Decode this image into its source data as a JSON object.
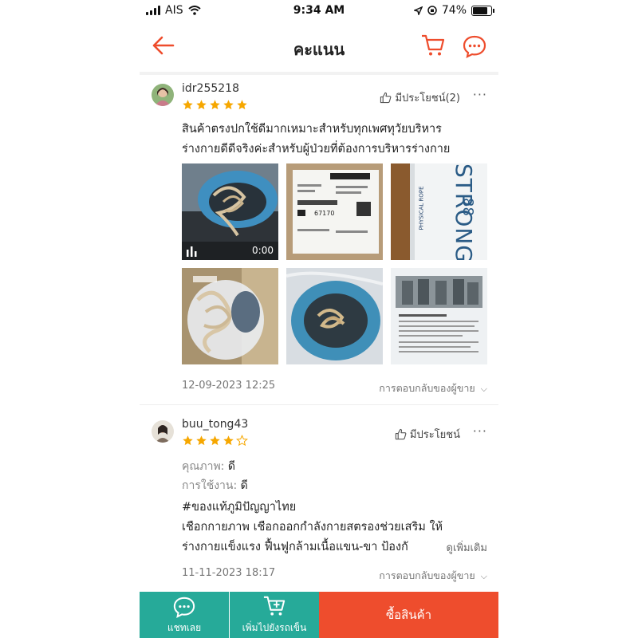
{
  "status_bar": {
    "carrier": "AIS",
    "time": "9:34 AM",
    "battery": "74%"
  },
  "header": {
    "title": "คะแนน",
    "back_icon": "arrow-left-icon",
    "cart_icon": "cart-icon",
    "chat_icon": "chat-icon"
  },
  "colors": {
    "accent": "#ee4d2d",
    "star": "#f6a700",
    "chat_green": "#26aa99"
  },
  "reviews": [
    {
      "username": "idr255218",
      "rating": 5,
      "helpful_label": "มีประโยชน์(2)",
      "text_lines": [
        "สินค้าตรงปกใช้ดีมากเหมาะสำหรับทุกเพศทุวัยบริหาร",
        "ร่างกายดีดีจริงค่ะสำหรับผู้ป่วยที่ต้องการบริหารร่างกาย"
      ],
      "video_duration": "0:00",
      "label_code": "67170",
      "packaging_text": "PHYSICAL ROPE",
      "packaging_brand": "STRONG",
      "packaging_number": "88",
      "date": "12-09-2023 12:25",
      "seller_reply_label": "การตอบกลับของผู้ขาย"
    },
    {
      "username": "buu_tong43",
      "rating": 4,
      "helpful_label": "มีประโยชน์",
      "attributes": [
        {
          "label": "คุณภาพ:",
          "value": "ดี"
        },
        {
          "label": "การใช้งาน:",
          "value": "ดี"
        }
      ],
      "text_lines": [
        "#ของแท้ภูมิปัญญาไทย",
        "เชือกกายภาพ เชือกออกกำลังกายสตรองช่วยเสริม ให้",
        "ร่างกายแข็งแรง ฟื้นฟูกล้ามเนื้อแขน-ขา ป้องกั"
      ],
      "see_more_label": "ดูเพิ่มเติม",
      "date": "11-11-2023 18:17",
      "seller_reply_label": "การตอบกลับของผู้ขาย"
    }
  ],
  "bottom_bar": {
    "chat_label": "แชทเลย",
    "add_to_cart_label": "เพิ่มไปยังรถเข็น",
    "buy_label": "ซื้อสินค้า"
  }
}
